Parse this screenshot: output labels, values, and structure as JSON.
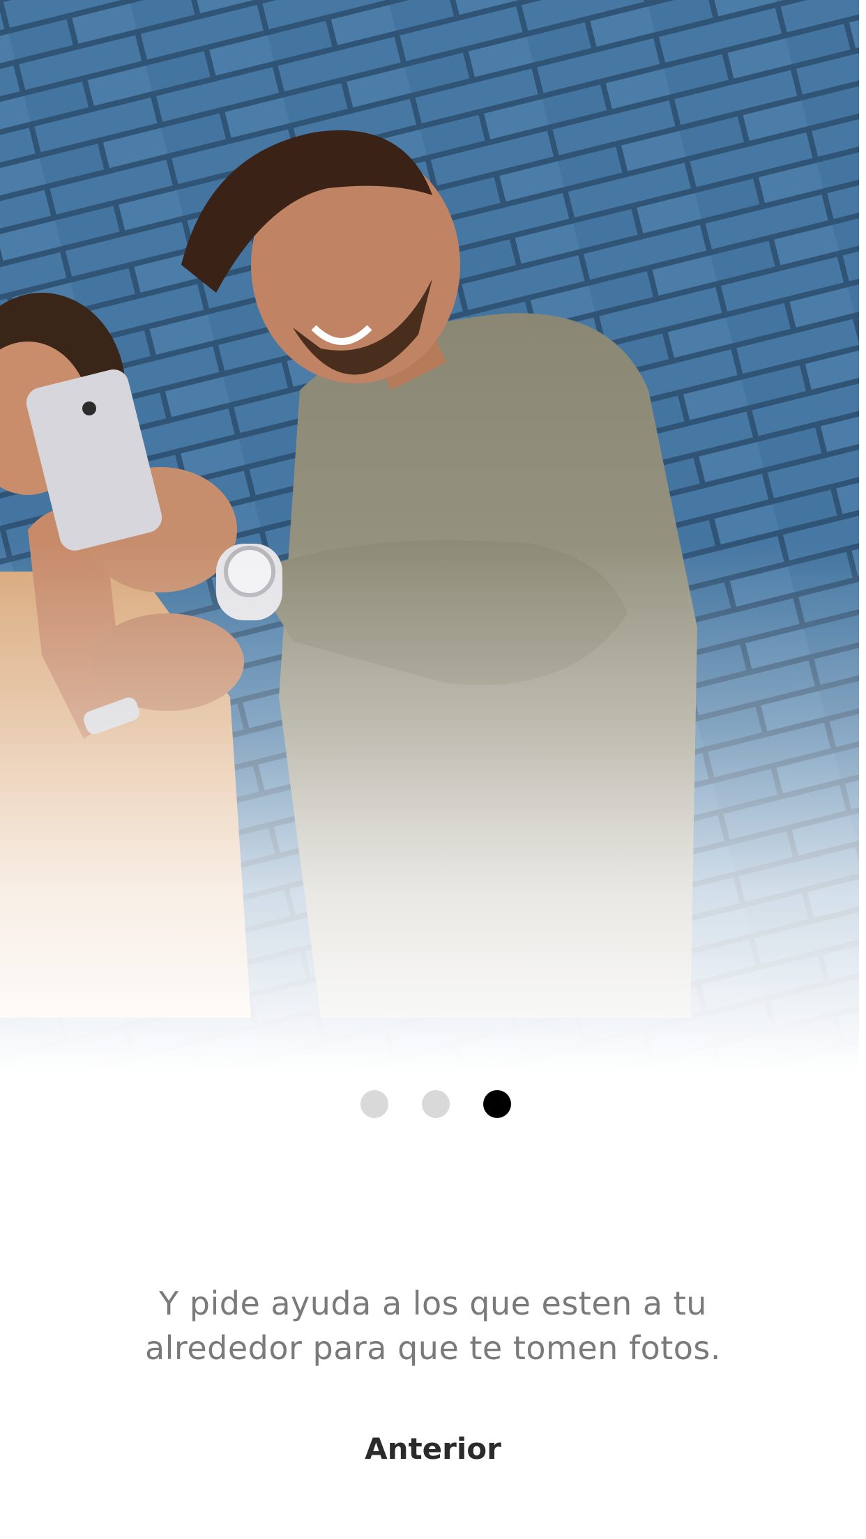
{
  "onboarding": {
    "hero_image": "photo of two people looking at a smartphone in front of a blue brick wall",
    "pager": {
      "total": 3,
      "active_index": 2,
      "dot_color": "#d9d9d9",
      "active_dot_color": "#000000"
    },
    "caption": "Y pide ayuda a los que esten a tu alrededor para que te tomen fotos.",
    "previous_label": "Anterior"
  },
  "colors": {
    "background": "#ffffff",
    "caption_text": "#7a7a7a",
    "button_text": "#2b2b2b",
    "brick_wall": "#3f6f99"
  }
}
